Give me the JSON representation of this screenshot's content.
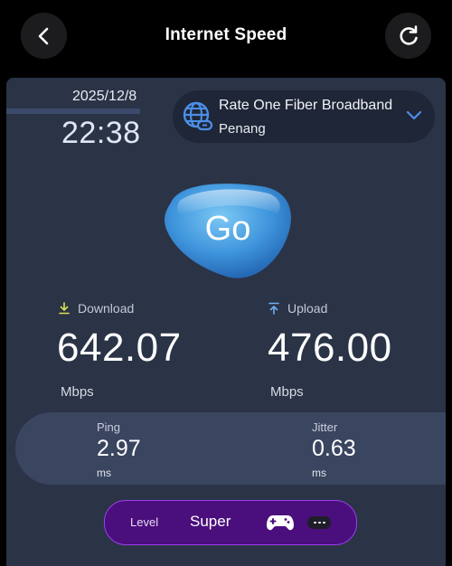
{
  "header": {
    "title": "Internet Speed",
    "back_icon": "chevron-left-icon",
    "refresh_icon": "refresh-icon"
  },
  "test": {
    "date": "2025/12/8",
    "time": "22:38"
  },
  "provider": {
    "name": "Rate One Fiber Broadband",
    "location": "Penang",
    "icon": "globe-network-icon"
  },
  "go_button": {
    "label": "Go"
  },
  "download": {
    "label": "Download",
    "value": "642.07",
    "unit": "Mbps",
    "icon": "download-arrow-icon"
  },
  "upload": {
    "label": "Upload",
    "value": "476.00",
    "unit": "Mbps",
    "icon": "upload-arrow-icon"
  },
  "ping": {
    "label": "Ping",
    "value": "2.97",
    "unit": "ms"
  },
  "jitter": {
    "label": "Jitter",
    "value": "0.63",
    "unit": "ms"
  },
  "level": {
    "label": "Level",
    "value": "Super",
    "icon": "gamepad-icon"
  },
  "colors": {
    "panel": "#2b3346",
    "accent_blue": "#4b8fe6",
    "level_purple": "#4a0f7c",
    "level_border": "#9b3df0"
  }
}
